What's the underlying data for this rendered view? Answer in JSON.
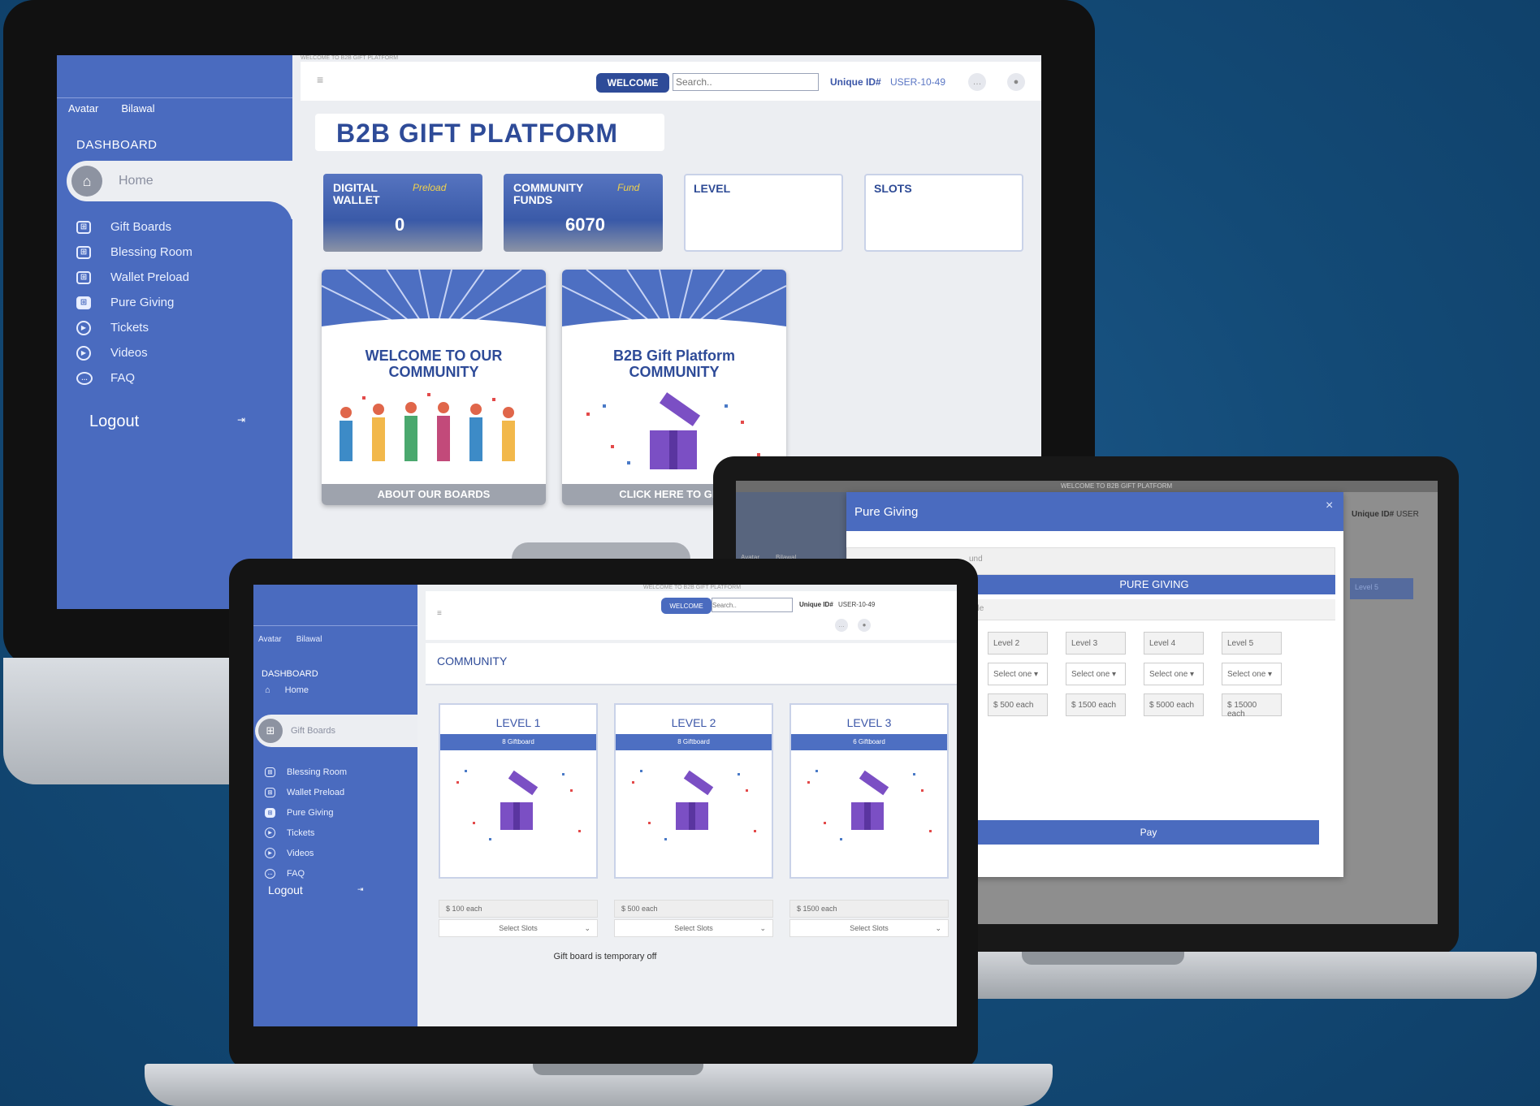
{
  "imac": {
    "top_caption": "WELCOME TO B2B GIFT PLATFORM",
    "user": {
      "avatar_alt": "Avatar",
      "name": "Bilawal"
    },
    "sidebar": {
      "section": "DASHBOARD",
      "home": "Home",
      "items": [
        {
          "label": "Gift Boards",
          "icon": "gift-icon"
        },
        {
          "label": "Blessing Room",
          "icon": "gift-icon"
        },
        {
          "label": "Wallet Preload",
          "icon": "gift-icon"
        },
        {
          "label": "Pure Giving",
          "icon": "gift-filled-icon"
        },
        {
          "label": "Tickets",
          "icon": "play-circle-icon"
        },
        {
          "label": "Videos",
          "icon": "play-circle-icon"
        },
        {
          "label": "FAQ",
          "icon": "chat-icon"
        }
      ],
      "logout": "Logout"
    },
    "topbar": {
      "menu_icon": "≡",
      "welcome": "WELCOME",
      "search_placeholder": "Search..",
      "unique_id_label": "Unique ID#",
      "unique_id_value": "USER-10-49"
    },
    "page_title": "B2B GIFT PLATFORM",
    "stats": [
      {
        "title": "DIGITAL\nWALLET",
        "tag": "Preload",
        "value": "0"
      },
      {
        "title": "COMMUNITY\nFUNDS",
        "tag": "Fund",
        "value": "6070"
      },
      {
        "title": "LEVEL"
      },
      {
        "title": "SLOTS"
      }
    ],
    "promos": [
      {
        "title": "WELCOME TO OUR\nCOMMUNITY",
        "footer": "ABOUT OUR BOARDS"
      },
      {
        "title": "B2B Gift Platform\nCOMMUNITY",
        "footer": "CLICK HERE TO GIVE"
      }
    ]
  },
  "laptop_back": {
    "top_caption": "WELCOME TO B2B GIFT PLATFORM",
    "modal_title": "Pure Giving",
    "modal_close": "×",
    "banner": "PURE GIVING",
    "fund_fragment": "und",
    "table_fragment": "ble",
    "unique_id_label": "Unique ID#",
    "unique_id_value": "USER",
    "sidebar_fragment": "Level 5",
    "avatar_alt": "Avatar",
    "name": "Bilawal",
    "levels": [
      {
        "label": "Level 2",
        "select": "Select one",
        "price": "$ 500 each"
      },
      {
        "label": "Level 3",
        "select": "Select one",
        "price": "$ 1500 each"
      },
      {
        "label": "Level 4",
        "select": "Select one",
        "price": "$ 5000 each"
      },
      {
        "label": "Level 5",
        "select": "Select one",
        "price": "$ 15000 each"
      }
    ],
    "pay": "Pay"
  },
  "laptop_front": {
    "top_caption": "WELCOME TO B2B GIFT PLATFORM",
    "user": {
      "avatar_alt": "Avatar",
      "name": "Bilawal"
    },
    "sidebar": {
      "section": "DASHBOARD",
      "home": "Home",
      "active": "Gift Boards",
      "items": [
        "Blessing Room",
        "Wallet Preload",
        "Pure Giving",
        "Tickets",
        "Videos",
        "FAQ"
      ],
      "logout": "Logout"
    },
    "topbar": {
      "welcome": "WELCOME",
      "search_placeholder": "Search..",
      "unique_id_label": "Unique ID#",
      "unique_id_value": "USER-10-49"
    },
    "section_title": "COMMUNITY",
    "levels": [
      {
        "title": "LEVEL 1",
        "band": "8 Giftboard",
        "price": "$ 100 each",
        "select": "Select Slots"
      },
      {
        "title": "LEVEL 2",
        "band": "8 Giftboard",
        "price": "$ 500 each",
        "select": "Select Slots"
      },
      {
        "title": "LEVEL 3",
        "band": "6 Giftboard",
        "price": "$ 1500 each",
        "select": "Select Slots"
      }
    ],
    "notice": "Gift board is temporary off"
  },
  "colors": {
    "sidebar": "#4a6bbf",
    "navy": "#2e4b98",
    "accent_yellow": "#f2d24b",
    "background": "#134a76"
  }
}
